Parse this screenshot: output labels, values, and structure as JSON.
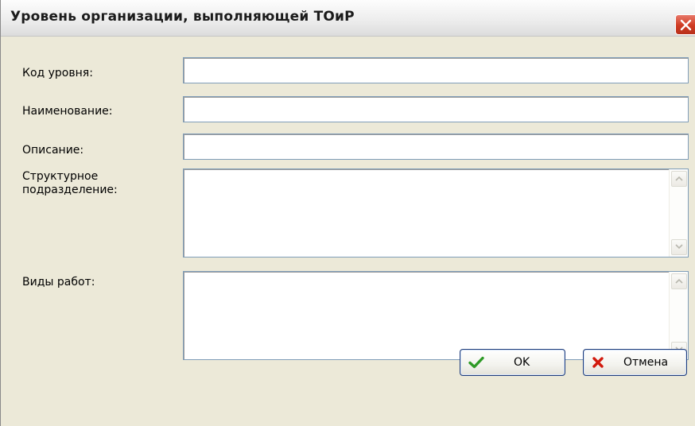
{
  "window": {
    "title": "Уровень организации, выполняющей ТОиР"
  },
  "form": {
    "fields": [
      {
        "label": "Код уровня:",
        "value": ""
      },
      {
        "label": "Наименование:",
        "value": ""
      },
      {
        "label": "Описание:",
        "value": ""
      },
      {
        "label": "Структурное подразделение:",
        "value": ""
      },
      {
        "label": "Виды работ:",
        "value": ""
      }
    ]
  },
  "buttons": {
    "ok_label": "OK",
    "cancel_label": "Отмена"
  },
  "icons": {
    "close": "close-icon",
    "ok": "checkmark-icon",
    "cancel": "cross-icon",
    "scroll_up": "arrow-up-icon",
    "scroll_down": "arrow-down-icon"
  },
  "colors": {
    "window_bg": "#ece9d8",
    "close_button": "#cf3b22",
    "ok_check": "#2e9a26",
    "cancel_cross": "#d21a0e",
    "field_border": "#7f9db9",
    "button_border": "#1f3c7a"
  }
}
